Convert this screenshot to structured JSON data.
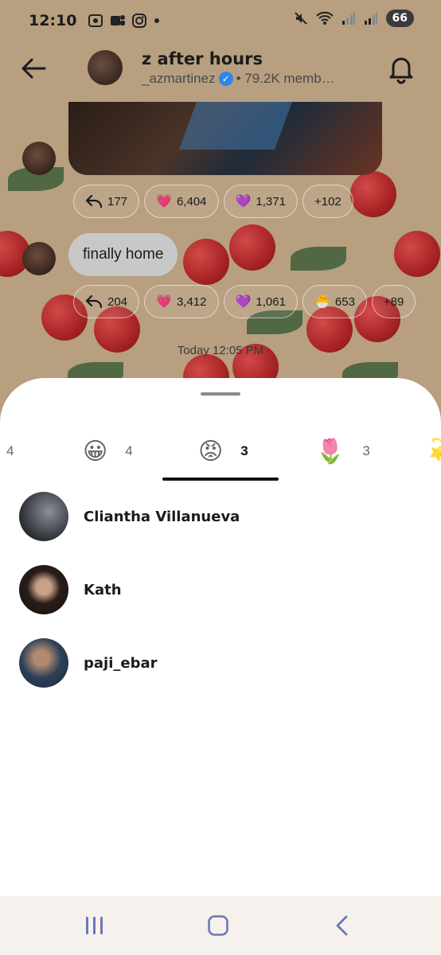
{
  "status_bar": {
    "time": "12:10",
    "battery": "66"
  },
  "header": {
    "title": "z after hours",
    "handle": "_azmartinez",
    "members": "• 79.2K memb…"
  },
  "messages": [
    {
      "type": "photo",
      "reactions": [
        {
          "icon": "reply-icon",
          "count": "177"
        },
        {
          "emoji": "💗",
          "count": "6,404"
        },
        {
          "emoji": "💜",
          "count": "1,371"
        },
        {
          "emoji": "",
          "count": "+102"
        }
      ]
    },
    {
      "type": "text",
      "text": "finally home",
      "reactions": [
        {
          "icon": "reply-icon",
          "count": "204"
        },
        {
          "emoji": "💗",
          "count": "3,412"
        },
        {
          "emoji": "💜",
          "count": "1,061"
        },
        {
          "emoji": "🐣",
          "count": "653"
        },
        {
          "emoji": "",
          "count": "+89"
        }
      ]
    }
  ],
  "date_separator": "Today 12:05 PM",
  "reaction_tabs": [
    {
      "emoji": "",
      "count": "4"
    },
    {
      "emoji": "😀",
      "count": "4"
    },
    {
      "emoji": "😡",
      "count": "3",
      "active": true
    },
    {
      "emoji": "🌷",
      "count": "3"
    },
    {
      "emoji": "💫",
      "count": ""
    }
  ],
  "reactors": [
    {
      "name": "Cliantha Villanueva"
    },
    {
      "name": "Kath"
    },
    {
      "name": "paji_ebar"
    }
  ]
}
